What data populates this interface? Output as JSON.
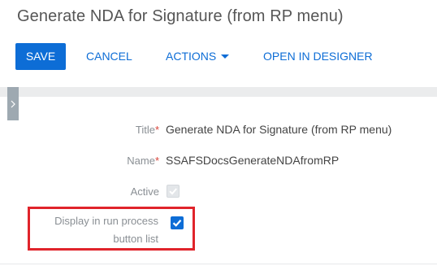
{
  "page": {
    "title": "Generate NDA for Signature (from RP menu)"
  },
  "toolbar": {
    "save_label": "SAVE",
    "cancel_label": "CANCEL",
    "actions_label": "ACTIONS",
    "designer_label": "OPEN IN DESIGNER"
  },
  "form": {
    "title_label": "Title",
    "title_value": "Generate NDA for Signature (from RP menu)",
    "name_label": "Name",
    "name_value": "SSAFSDocsGenerateNDAfromRP",
    "required_mark": "*",
    "active_label": "Active",
    "active_checked": true,
    "active_disabled": true,
    "run_process_label_line1": "Display in run process",
    "run_process_label_line2": "button list",
    "run_process_checked": true
  },
  "icons": {
    "side_tab": "chevron-right-icon",
    "actions_caret": "caret-down-icon",
    "checkmark": "checkmark-icon"
  },
  "colors": {
    "accent": "#0d6dd6",
    "highlight": "#e0242b",
    "required": "#d9433a"
  }
}
